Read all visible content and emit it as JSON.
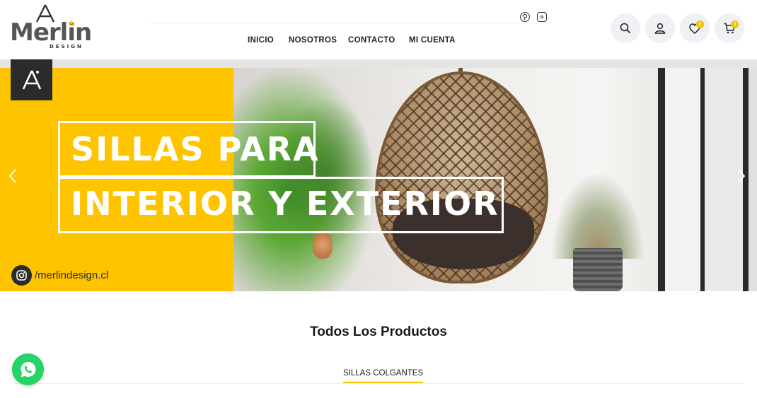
{
  "brand": {
    "name": "Merlin",
    "tagline": "DESIGN",
    "accent_color": "#f3c300"
  },
  "social_icons": [
    "pinterest-icon",
    "instagram-icon"
  ],
  "nav": {
    "items": [
      {
        "label": "INICIO"
      },
      {
        "label": "NOSOTROS"
      },
      {
        "label": "CONTACTO"
      },
      {
        "label": "MI CUENTA"
      }
    ]
  },
  "header_actions": {
    "search_icon": "search-icon",
    "account_icon": "user-icon",
    "wishlist_count": "0",
    "cart_count": "0"
  },
  "banner": {
    "headline_line1": "SILLAS PARA",
    "headline_line2": "INTERIOR Y EXTERIOR",
    "instagram_handle": "/merlindesign.cl",
    "background_color": "#ffc400"
  },
  "products_section": {
    "title": "Todos Los Productos",
    "active_tab": "SILLAS COLGANTES"
  },
  "whatsapp": {
    "color": "#25d366"
  }
}
